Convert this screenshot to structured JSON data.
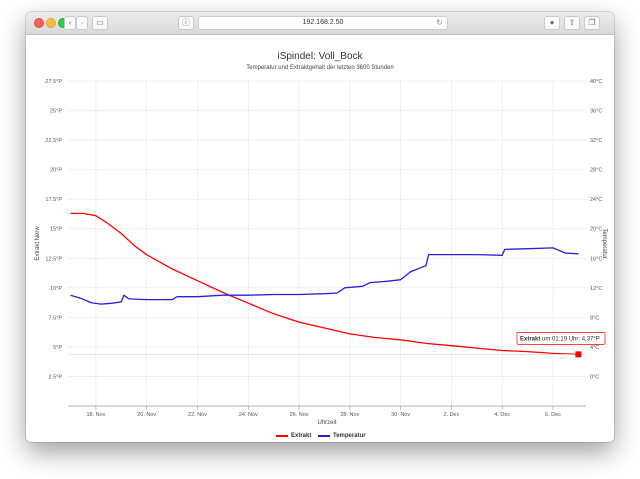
{
  "browser": {
    "url": "192.168.2.50",
    "back_icon": "chevron-left-icon",
    "forward_icon": "chevron-right-icon",
    "sidebar_icon": "sidebar-icon",
    "info_icon": "info-icon",
    "reload_icon": "reload-icon",
    "download_icon": "download-icon",
    "share_icon": "share-icon",
    "tabs_icon": "tabs-icon",
    "newtab_icon": "plus-icon"
  },
  "chart_data": {
    "type": "line",
    "title": "iSpindel: Voll_Bock",
    "subtitle": "Temperatur und Extraktgehalt der letzten 3600 Stunden",
    "xlabel": "Uhrzeit",
    "ylabel_left": "Extrakt Nerw",
    "ylabel_right": "Temperatur",
    "x_ticks": [
      "18. Nov",
      "20. Nov",
      "22. Nov",
      "24. Nov",
      "26. Nov",
      "28. Nov",
      "30. Nov",
      "2. Dec",
      "4. Dec",
      "6. Dec"
    ],
    "x_range": [
      16.9,
      37.3
    ],
    "y_left_ticks": [
      "27.5°P",
      "25°P",
      "22.5°P",
      "20°P",
      "17.5°P",
      "15°P",
      "12.5°P",
      "10°P",
      "7.5°P",
      "5°P",
      "2.5°P"
    ],
    "y_left_range": [
      0,
      27.5
    ],
    "y_right_ticks": [
      "40°C",
      "36°C",
      "32°C",
      "28°C",
      "24°C",
      "20°C",
      "16°C",
      "12°C",
      "8°C",
      "4°C",
      "0°C"
    ],
    "y_right_range": [
      -4,
      40
    ],
    "grid": true,
    "legend_position": "bottom-center",
    "tooltip": {
      "series": "Extrakt",
      "text": " um 01:19 Uhr: 4,37°P"
    },
    "series": [
      {
        "name": "Extrakt",
        "color": "#ff0000",
        "axis": "left",
        "points": [
          [
            17.0,
            16.3
          ],
          [
            17.5,
            16.3
          ],
          [
            18.0,
            16.1
          ],
          [
            18.5,
            15.4
          ],
          [
            19.0,
            14.6
          ],
          [
            19.5,
            13.6
          ],
          [
            20.0,
            12.8
          ],
          [
            21.0,
            11.6
          ],
          [
            22.0,
            10.6
          ],
          [
            23.0,
            9.6
          ],
          [
            24.0,
            8.7
          ],
          [
            25.0,
            7.8
          ],
          [
            26.0,
            7.1
          ],
          [
            27.0,
            6.6
          ],
          [
            28.0,
            6.1
          ],
          [
            29.0,
            5.8
          ],
          [
            30.0,
            5.6
          ],
          [
            31.0,
            5.3
          ],
          [
            32.0,
            5.1
          ],
          [
            33.0,
            4.9
          ],
          [
            34.0,
            4.7
          ],
          [
            35.0,
            4.6
          ],
          [
            36.0,
            4.45
          ],
          [
            37.0,
            4.37
          ]
        ]
      },
      {
        "name": "Temperatur",
        "color": "#2222dd",
        "axis": "right",
        "points": [
          [
            17.0,
            11.0
          ],
          [
            17.4,
            10.6
          ],
          [
            17.8,
            10.0
          ],
          [
            18.2,
            9.8
          ],
          [
            18.6,
            9.9
          ],
          [
            19.0,
            10.1
          ],
          [
            19.1,
            11.0
          ],
          [
            19.3,
            10.5
          ],
          [
            20.0,
            10.4
          ],
          [
            21.0,
            10.4
          ],
          [
            21.2,
            10.8
          ],
          [
            22.0,
            10.8
          ],
          [
            23.0,
            11.0
          ],
          [
            24.0,
            11.0
          ],
          [
            25.0,
            11.1
          ],
          [
            26.0,
            11.1
          ],
          [
            27.0,
            11.2
          ],
          [
            27.5,
            11.3
          ],
          [
            27.8,
            12.0
          ],
          [
            28.5,
            12.2
          ],
          [
            28.8,
            12.7
          ],
          [
            29.5,
            12.9
          ],
          [
            30.0,
            13.1
          ],
          [
            30.4,
            14.2
          ],
          [
            31.0,
            15.0
          ],
          [
            31.1,
            16.5
          ],
          [
            32.0,
            16.5
          ],
          [
            33.0,
            16.5
          ],
          [
            34.0,
            16.4
          ],
          [
            34.1,
            17.2
          ],
          [
            35.0,
            17.3
          ],
          [
            36.0,
            17.4
          ],
          [
            36.5,
            16.7
          ],
          [
            37.0,
            16.6
          ]
        ]
      }
    ]
  }
}
